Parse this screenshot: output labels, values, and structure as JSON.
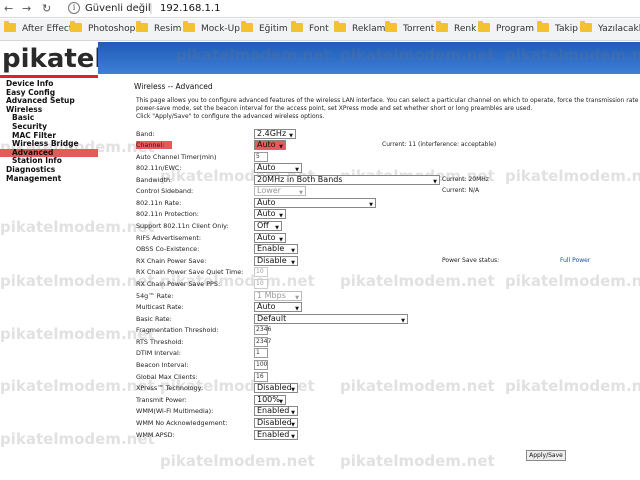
{
  "browser": {
    "security_label": "Güvenli değil",
    "url": "192.168.1.1",
    "bookmarks": [
      "After Effect",
      "Photoshop",
      "Resim",
      "Mock-Up",
      "Eğitim",
      "Font",
      "Reklam",
      "Torrent",
      "Renk",
      "Program",
      "Takip",
      "Yazılacaklar"
    ]
  },
  "logo": "pikatel",
  "watermark": "pikatelmodem.net",
  "sidebar": {
    "items": [
      {
        "label": "Device Info",
        "level": 0
      },
      {
        "label": "Easy Config",
        "level": 0
      },
      {
        "label": "Advanced Setup",
        "level": 0
      },
      {
        "label": "Wireless",
        "level": 0
      },
      {
        "label": "Basic",
        "level": 1
      },
      {
        "label": "Security",
        "level": 1
      },
      {
        "label": "MAC Filter",
        "level": 1
      },
      {
        "label": "Wireless Bridge",
        "level": 1
      },
      {
        "label": "Advanced",
        "level": 1,
        "active": true
      },
      {
        "label": "Station Info",
        "level": 1
      },
      {
        "label": "Diagnostics",
        "level": 0
      },
      {
        "label": "Management",
        "level": 0
      }
    ]
  },
  "main": {
    "title": "Wireless -- Advanced",
    "description_1": "This page allows you to configure advanced features of the wireless LAN interface. You can select a particular channel on which to operate, force the transmission rate to a particular speed, set the fragmentation threshold, set the RTS threshold, set the wakeup interval for clients in",
    "description_2": "power-save mode, set the beacon interval for the access point, set XPress mode and set whether short or long preambles are used.",
    "description_3": "Click \"Apply/Save\" to configure the advanced wireless options.",
    "apply_label": "Apply/Save"
  },
  "fields": {
    "band": {
      "label": "Band:",
      "value": "2.4GHz"
    },
    "channel": {
      "label": "Channel:",
      "value": "Auto",
      "current": "Current: 11 (interference: acceptable)"
    },
    "auto_timer": {
      "label": "Auto Channel Timer(min)",
      "value": "5"
    },
    "n_ewc": {
      "label": "802.11n/EWC:",
      "value": "Auto"
    },
    "bandwidth": {
      "label": "Bandwidth:",
      "value": "20MHz in Both Bands",
      "current": "Current: 20MHz"
    },
    "sideband": {
      "label": "Control Sideband:",
      "value": "Lower",
      "current": "Current: N/A"
    },
    "n_rate": {
      "label": "802.11n Rate:",
      "value": "Auto"
    },
    "n_protection": {
      "label": "802.11n Protection:",
      "value": "Auto"
    },
    "n_client_only": {
      "label": "Support 802.11n Client Only:",
      "value": "Off"
    },
    "rifs": {
      "label": "RIFS Advertisement:",
      "value": "Auto"
    },
    "obss": {
      "label": "OBSS Co-Existence:",
      "value": "Enable"
    },
    "rx_chain": {
      "label": "RX Chain Power Save:",
      "value": "Disable",
      "status_label": "Power Save status:",
      "status_value": "Full Power"
    },
    "rx_quiet": {
      "label": "RX Chain Power Save Quiet Time:",
      "value": "10"
    },
    "rx_pps": {
      "label": "RX Chain Power Save PPS:",
      "value": "10"
    },
    "g_rate": {
      "label": "54g™ Rate:",
      "value": "1 Mbps"
    },
    "multicast": {
      "label": "Multicast Rate:",
      "value": "Auto"
    },
    "basic_rate": {
      "label": "Basic Rate:",
      "value": "Default"
    },
    "frag": {
      "label": "Fragmentation Threshold:",
      "value": "2346"
    },
    "rts": {
      "label": "RTS Threshold:",
      "value": "2347"
    },
    "dtim": {
      "label": "DTIM Interval:",
      "value": "1"
    },
    "beacon": {
      "label": "Beacon Interval:",
      "value": "100"
    },
    "max_clients": {
      "label": "Global Max Clients:",
      "value": "16"
    },
    "xpress": {
      "label": "XPress™ Technology:",
      "value": "Disabled"
    },
    "tx_power": {
      "label": "Transmit Power:",
      "value": "100%"
    },
    "wmm": {
      "label": "WMM(Wi-Fi Multimedia):",
      "value": "Enabled"
    },
    "wmm_noack": {
      "label": "WMM No Acknowledgement:",
      "value": "Disabled"
    },
    "wmm_apsd": {
      "label": "WMM APSD:",
      "value": "Enabled"
    }
  }
}
